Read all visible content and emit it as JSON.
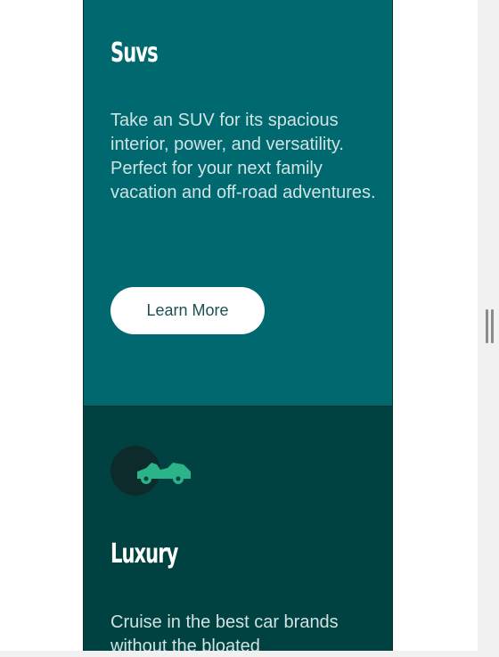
{
  "cards": {
    "suvs": {
      "title": "Suvs",
      "description": "Take an SUV for its spacious interior, power, and versatility. Perfect for your next family vacation and off-road adventures.",
      "button_label": "Learn More"
    },
    "luxury": {
      "icon": "car-icon",
      "title": "Luxury",
      "description": "Cruise in the best car brands without the bloated"
    }
  },
  "colors": {
    "suvs_bg": "#006970",
    "luxury_bg": "#004241",
    "icon_accent": "#2bb38a",
    "button_bg": "#ffffff",
    "button_text": "#1b4f55"
  }
}
